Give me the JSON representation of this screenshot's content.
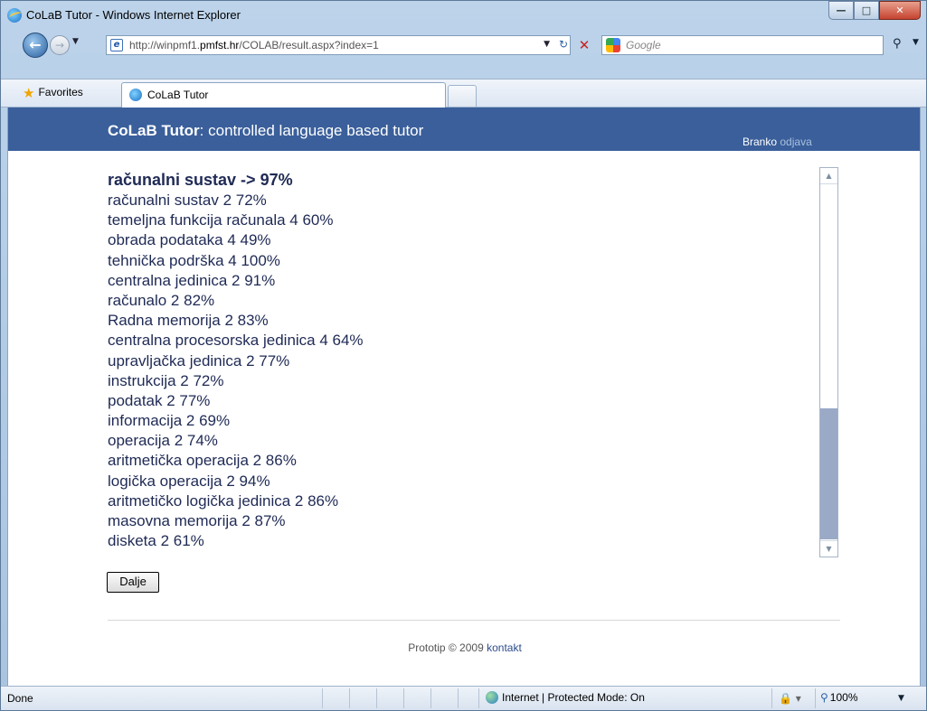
{
  "window": {
    "title": "CoLaB Tutor - Windows Internet Explorer"
  },
  "address": {
    "url_prefix": "http://winpmf1.",
    "url_domain": "pmfst.hr",
    "url_path": "/COLAB/result.aspx?index=1"
  },
  "search": {
    "placeholder": "Google"
  },
  "favorites": {
    "label": "Favorites"
  },
  "tab": {
    "label": "CoLaB Tutor"
  },
  "site": {
    "title_bold": "CoLaB Tutor",
    "title_rest": ": controlled language based tutor",
    "user": "Branko",
    "logout": "odjava"
  },
  "results": {
    "heading": "računalni sustav -> 97%",
    "items": [
      "računalni sustav 2 72%",
      "temeljna funkcija računala 4 60%",
      "obrada podataka 4 49%",
      "tehnička podrška 4 100%",
      "centralna jedinica 2 91%",
      "računalo 2 82%",
      "Radna memorija 2 83%",
      "centralna procesorska jedinica 4 64%",
      "upravljačka jedinica 2 77%",
      "instrukcija 2 72%",
      "podatak 2 77%",
      "informacija 2 69%",
      "operacija 2 74%",
      "aritmetička operacija 2 86%",
      "logička operacija 2 94%",
      "aritmetičko logička jedinica 2 86%",
      "masovna memorija 2 87%",
      "disketa 2 61%"
    ],
    "next_button": "Dalje"
  },
  "footer": {
    "text": "Prototip © 2009 ",
    "link": "kontakt"
  },
  "status": {
    "text": "Done",
    "zone": "Internet | Protected Mode: On",
    "zoom": "100%"
  },
  "icons": {
    "back": "back-arrow-icon",
    "forward": "forward-arrow-icon",
    "refresh": "refresh-icon",
    "stop": "stop-icon",
    "search": "search-icon",
    "favorites": "star-icon",
    "globe": "globe-icon",
    "zoom": "zoom-icon"
  }
}
